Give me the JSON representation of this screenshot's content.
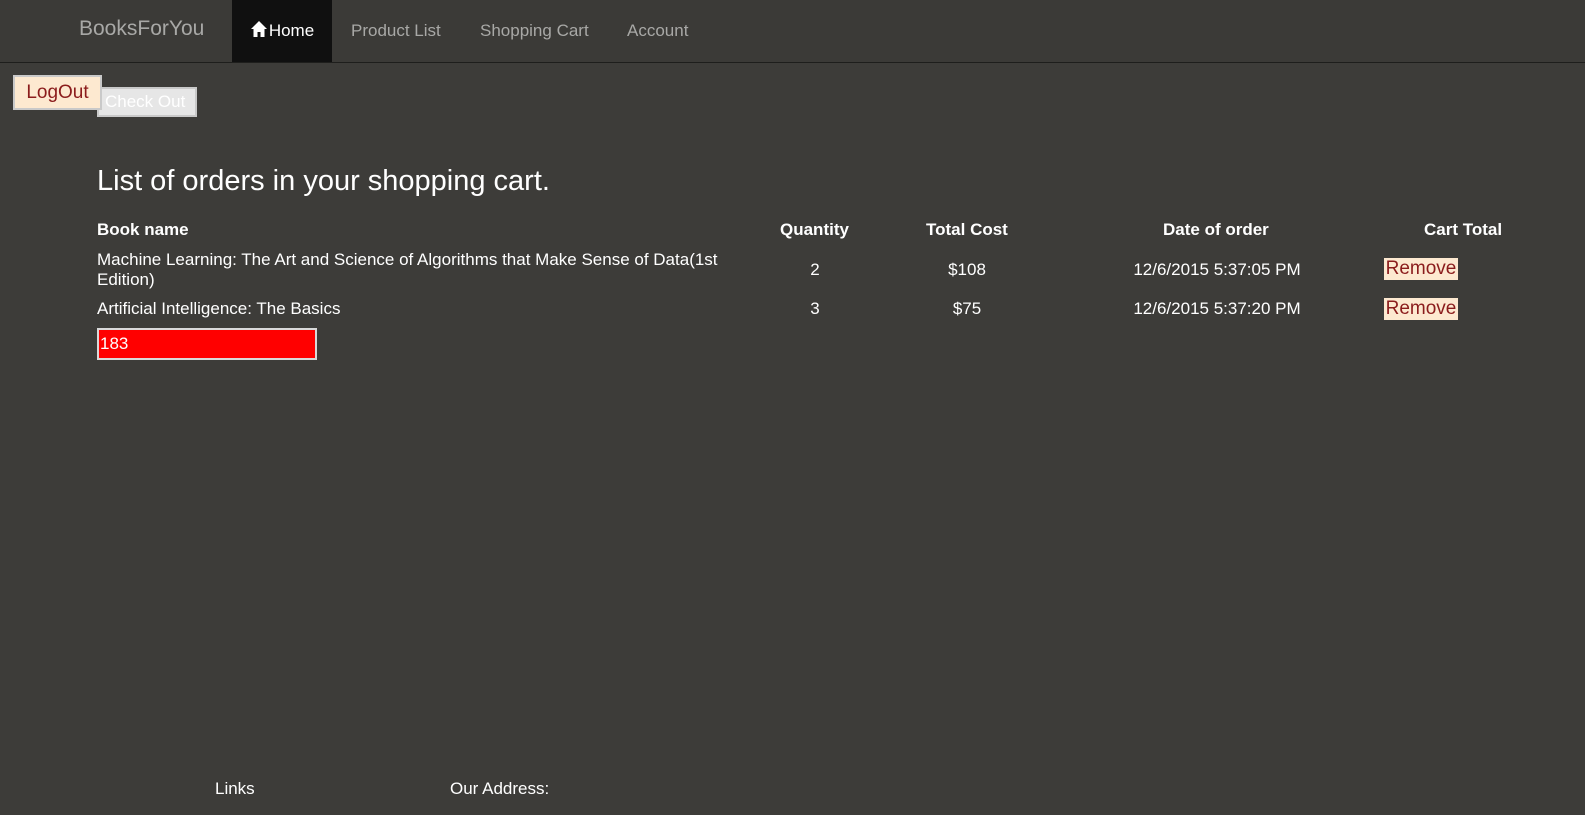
{
  "navbar": {
    "brand": "BooksForYou",
    "items": [
      {
        "label": "Home",
        "icon": "home-icon",
        "active": true
      },
      {
        "label": "Product List"
      },
      {
        "label": "Shopping Cart"
      },
      {
        "label": "Account"
      }
    ]
  },
  "actions": {
    "logout_label": "LogOut",
    "checkout_label": "Check Out"
  },
  "cart": {
    "title": "List of orders in your shopping cart.",
    "columns": [
      "Book name",
      "Quantity",
      "Total Cost",
      "Date of order",
      "Cart Total"
    ],
    "rows": [
      {
        "book_name": "Machine Learning: The Art and Science of Algorithms that Make Sense of Data(1st Edition)",
        "quantity": "2",
        "total_cost": "$108",
        "date": "12/6/2015 5:37:05 PM",
        "remove_label": "Remove"
      },
      {
        "book_name": "Artificial Intelligence: The Basics",
        "quantity": "3",
        "total_cost": "$75",
        "date": "12/6/2015 5:37:20 PM",
        "remove_label": "Remove"
      }
    ],
    "total_value": "183"
  },
  "footer": {
    "links_heading": "Links",
    "address_heading": "Our Address:"
  },
  "colors": {
    "background": "#3d3c39",
    "navbar_active": "#101010",
    "button_bg": "#fde9d0",
    "button_text": "#8b1c1c",
    "total_bg": "#ff0000"
  }
}
